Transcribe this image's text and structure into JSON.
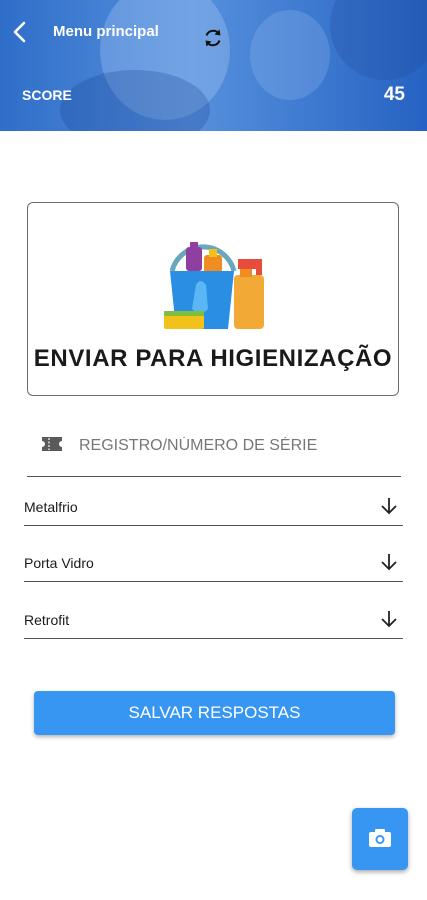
{
  "header": {
    "title": "Menu principal",
    "score_label": "SCORE",
    "score_value": "45",
    "icons": [
      "back-arrow-icon",
      "refresh-icon"
    ]
  },
  "card": {
    "label": "ENVIAR PARA HIGIENIZAÇÃO",
    "icon": "cleaning-bucket-icon"
  },
  "serial": {
    "placeholder": "REGISTRO/NÚMERO DE SÉRIE",
    "value": "",
    "icon": "ticket-icon"
  },
  "selects": [
    {
      "value": "Metalfrio"
    },
    {
      "value": "Porta Vidro"
    },
    {
      "value": "Retrofit"
    }
  ],
  "actions": {
    "save_label": "SALVAR RESPOSTAS",
    "camera_icon": "camera-icon"
  },
  "colors": {
    "primary": "#3896f3",
    "header": "#3c78cf"
  }
}
